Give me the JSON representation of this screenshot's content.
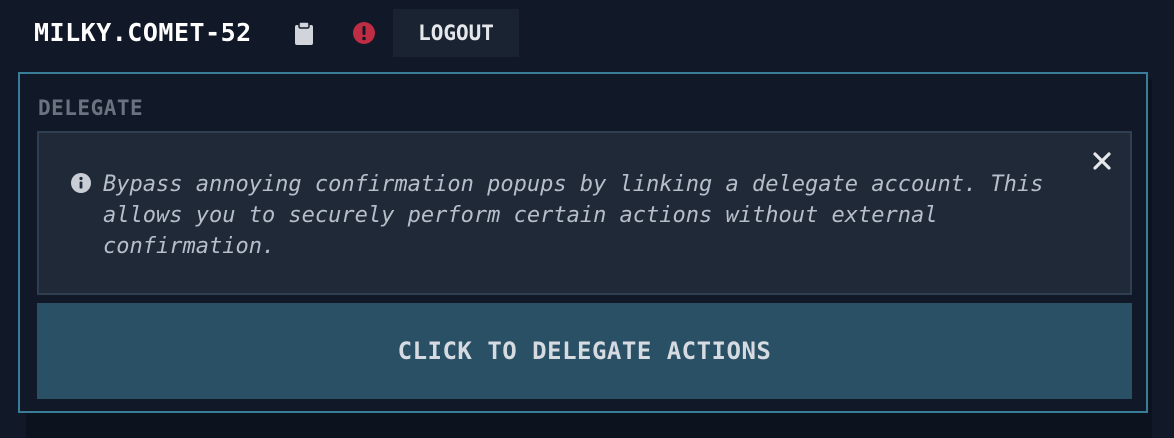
{
  "header": {
    "username": "MILKY.COMET-52",
    "copy_icon": "clipboard-icon",
    "alert_icon": "exclamation-circle-icon",
    "alert_color": "#be2d44",
    "logout_label": "LOGOUT"
  },
  "panel": {
    "title": "DELEGATE",
    "accent_color": "#3a7d98",
    "info": {
      "icon": "info-circle-icon",
      "close_icon": "close-icon",
      "message": "Bypass annoying confirmation popups by linking a delegate account. This allows you to securely perform certain actions without external confirmation."
    },
    "action_label": "CLICK TO DELEGATE ACTIONS",
    "action_color": "#2a5066"
  }
}
